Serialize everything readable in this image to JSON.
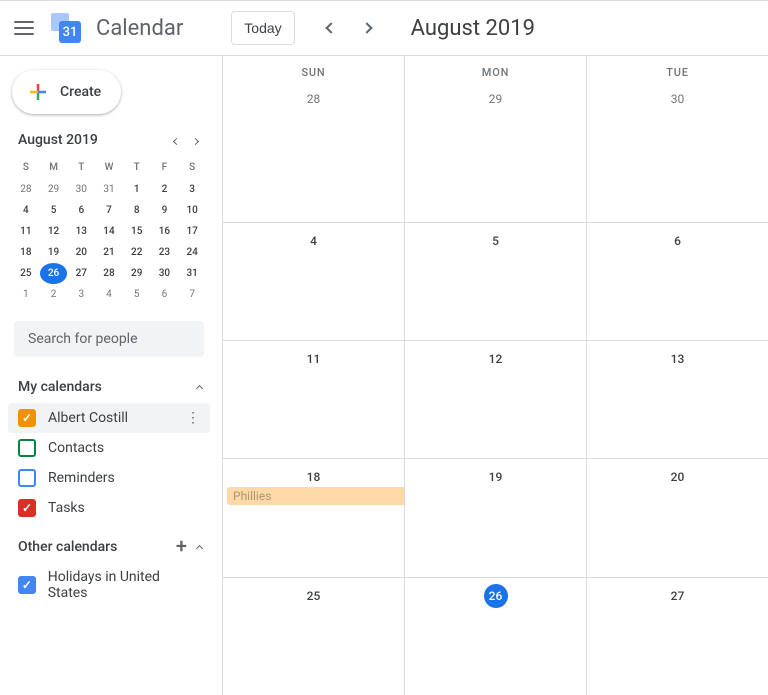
{
  "header": {
    "logo_day": "31",
    "app_title": "Calendar",
    "today_label": "Today",
    "month_title": "August 2019"
  },
  "sidebar": {
    "create_label": "Create",
    "mini_title": "August 2019",
    "mini_dow": [
      "S",
      "M",
      "T",
      "W",
      "T",
      "F",
      "S"
    ],
    "mini_days": [
      {
        "n": "28",
        "b": false
      },
      {
        "n": "29",
        "b": false
      },
      {
        "n": "30",
        "b": false
      },
      {
        "n": "31",
        "b": false
      },
      {
        "n": "1",
        "b": true
      },
      {
        "n": "2",
        "b": true
      },
      {
        "n": "3",
        "b": true
      },
      {
        "n": "4",
        "b": true
      },
      {
        "n": "5",
        "b": true
      },
      {
        "n": "6",
        "b": true
      },
      {
        "n": "7",
        "b": true
      },
      {
        "n": "8",
        "b": true
      },
      {
        "n": "9",
        "b": true
      },
      {
        "n": "10",
        "b": true
      },
      {
        "n": "11",
        "b": true
      },
      {
        "n": "12",
        "b": true
      },
      {
        "n": "13",
        "b": true
      },
      {
        "n": "14",
        "b": true
      },
      {
        "n": "15",
        "b": true
      },
      {
        "n": "16",
        "b": true
      },
      {
        "n": "17",
        "b": true
      },
      {
        "n": "18",
        "b": true
      },
      {
        "n": "19",
        "b": true
      },
      {
        "n": "20",
        "b": true
      },
      {
        "n": "21",
        "b": true
      },
      {
        "n": "22",
        "b": true
      },
      {
        "n": "23",
        "b": true
      },
      {
        "n": "24",
        "b": true
      },
      {
        "n": "25",
        "b": true
      },
      {
        "n": "26",
        "b": true,
        "sel": true
      },
      {
        "n": "27",
        "b": true
      },
      {
        "n": "28",
        "b": true
      },
      {
        "n": "29",
        "b": true
      },
      {
        "n": "30",
        "b": true
      },
      {
        "n": "31",
        "b": true
      },
      {
        "n": "1",
        "b": false
      },
      {
        "n": "2",
        "b": false
      },
      {
        "n": "3",
        "b": false
      },
      {
        "n": "4",
        "b": false
      },
      {
        "n": "5",
        "b": false
      },
      {
        "n": "6",
        "b": false
      },
      {
        "n": "7",
        "b": false
      }
    ],
    "search_placeholder": "Search for people",
    "my_cal_label": "My calendars",
    "my_cals": [
      {
        "label": "Albert Costill",
        "color": "#f09300",
        "checked": true,
        "active": true
      },
      {
        "label": "Contacts",
        "color": "#0b8043",
        "checked": false
      },
      {
        "label": "Reminders",
        "color": "#4285f4",
        "checked": false
      },
      {
        "label": "Tasks",
        "color": "#d93025",
        "checked": true
      }
    ],
    "other_cal_label": "Other calendars",
    "other_cals": [
      {
        "label": "Holidays in United States",
        "color": "#4285f4",
        "checked": true
      }
    ]
  },
  "grid": {
    "dow": [
      "SUN",
      "MON",
      "TUE"
    ],
    "weeks": [
      [
        {
          "n": "28"
        },
        {
          "n": "29"
        },
        {
          "n": "30"
        }
      ],
      [
        {
          "n": "4",
          "cur": true
        },
        {
          "n": "5",
          "cur": true
        },
        {
          "n": "6",
          "cur": true
        }
      ],
      [
        {
          "n": "11",
          "cur": true
        },
        {
          "n": "12",
          "cur": true
        },
        {
          "n": "13",
          "cur": true
        }
      ],
      [
        {
          "n": "18",
          "cur": true,
          "event": "Phillies"
        },
        {
          "n": "19",
          "cur": true
        },
        {
          "n": "20",
          "cur": true
        }
      ],
      [
        {
          "n": "25",
          "cur": true
        },
        {
          "n": "26",
          "cur": true,
          "today": true
        },
        {
          "n": "27",
          "cur": true
        }
      ]
    ]
  }
}
